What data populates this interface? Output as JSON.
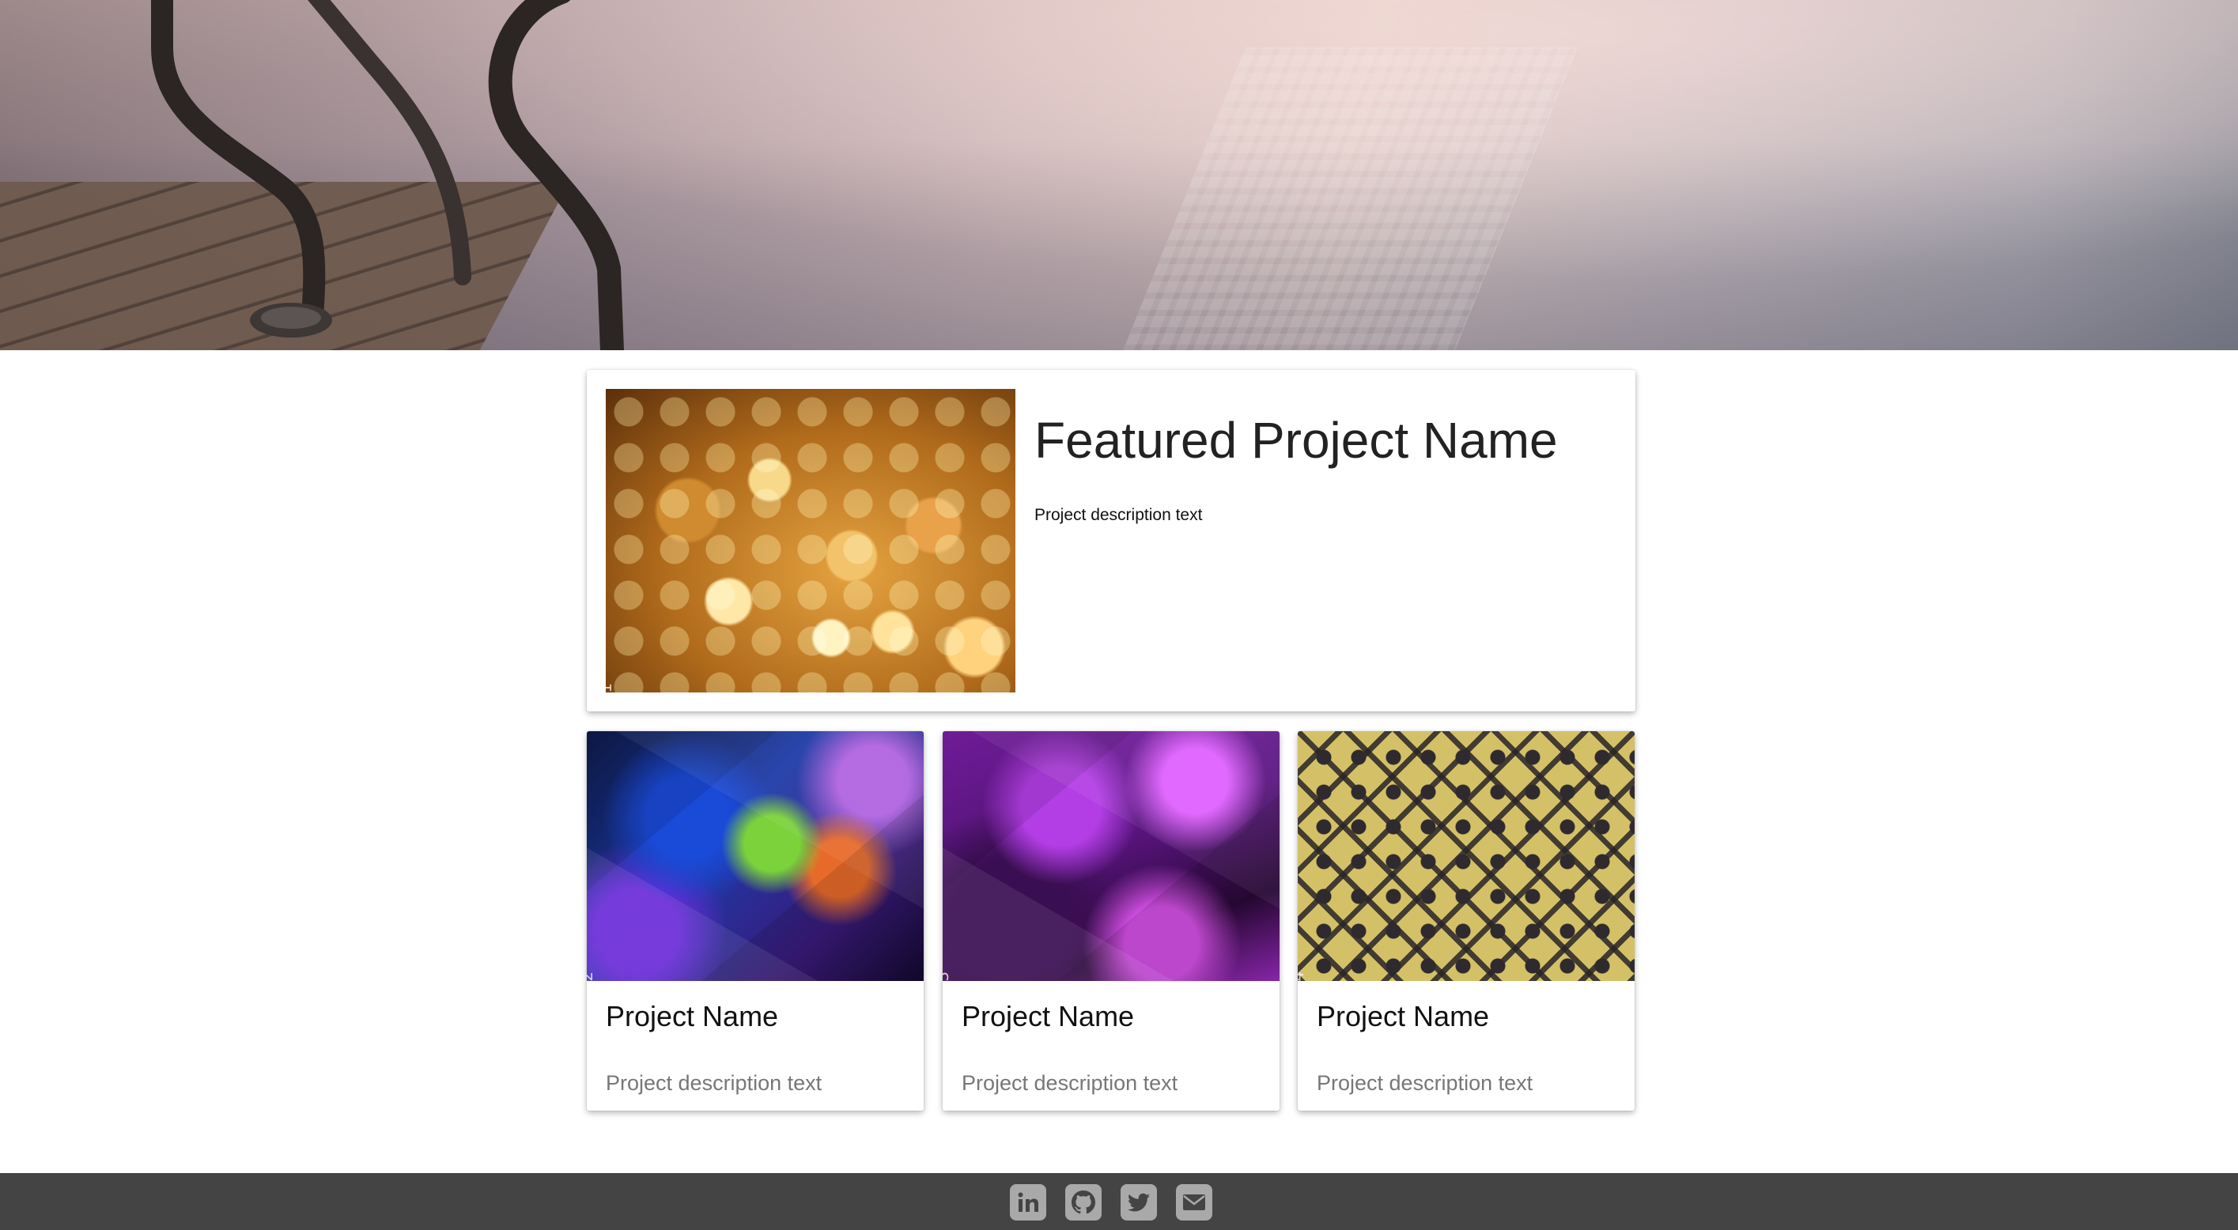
{
  "hero": {
    "icons": [
      "pool-ladder"
    ]
  },
  "featured": {
    "image_label": "placeholder-1",
    "title": "Featured Project Name",
    "description": "Project description text"
  },
  "projects": [
    {
      "image_label": "placeholder-2",
      "name": "Project Name",
      "description": "Project description text"
    },
    {
      "image_label": "placeholder-3",
      "name": "Project Name",
      "description": "Project description text"
    },
    {
      "image_label": "placeholder-4",
      "name": "Project Name",
      "description": "Project description text"
    }
  ],
  "footer": {
    "social_icons": [
      "linkedin-icon",
      "github-icon",
      "twitter-icon",
      "email-icon"
    ],
    "background": "#444444",
    "icon_color": "#a9a9a9"
  }
}
